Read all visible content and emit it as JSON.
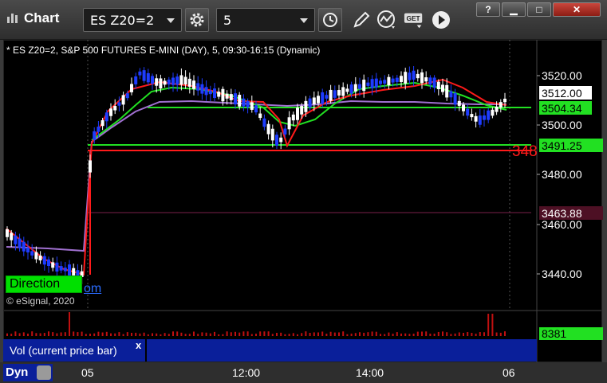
{
  "window": {
    "title": "Chart",
    "buttons": {
      "help": "?",
      "minimize": "▁",
      "maximize": "□",
      "close": "✕"
    }
  },
  "toolbar": {
    "symbol": "ES Z20=2",
    "interval": "5",
    "icons": [
      "gear-icon",
      "clock-icon",
      "pencil-icon",
      "study-icon",
      "get-icon",
      "play-icon"
    ],
    "get_label": "GET"
  },
  "chart": {
    "description": "* ES Z20=2, S&P 500 FUTURES E-MINI (DAY), 5, 09:30-16:15 (Dynamic)",
    "copyright": "© eSignal, 2020",
    "direction_label": "Direction",
    "link_fragment": "om",
    "red_level_label": "348",
    "price_ticks": [
      "3520.00",
      "3500.00",
      "3480.00",
      "3460.00",
      "3440.00"
    ],
    "price_tags": {
      "last": "3512.00",
      "green_ma": "3504.34",
      "green_level": "3491.25",
      "purple_level": "3463.88"
    },
    "colors": {
      "up_candle": "#ffffff",
      "down_candle": "#1e3cff",
      "ma_red": "#ff1a1a",
      "ma_green": "#22e022",
      "ma_purple": "#a070d0",
      "level_green": "#22e022",
      "level_red": "#ff1a1a",
      "level_purple": "#7a1f4a"
    }
  },
  "volume": {
    "label": "Vol (current price bar)",
    "close": "x",
    "value": "8381"
  },
  "time_axis": {
    "labels": [
      "05",
      "12:00",
      "14:00",
      "06"
    ],
    "dyn_label": "Dyn"
  }
}
